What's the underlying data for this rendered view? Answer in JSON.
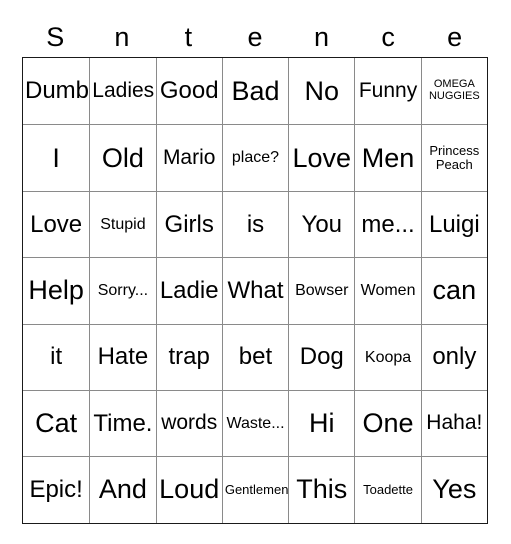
{
  "card": {
    "header_letters": [
      "S",
      "n",
      "t",
      "e",
      "n",
      "c",
      "e"
    ],
    "border_color": "#1a1a1a",
    "gridline_color": "#8a8a8a",
    "background_color": "#ffffff",
    "text_color": "#000000",
    "columns": 7,
    "rows": 7,
    "cells": [
      [
        {
          "text": "Dumb",
          "size": "lg"
        },
        {
          "text": "Ladies",
          "size": "md"
        },
        {
          "text": "Good",
          "size": "lg"
        },
        {
          "text": "Bad",
          "size": "xl"
        },
        {
          "text": "No",
          "size": "xl"
        },
        {
          "text": "Funny",
          "size": "md"
        },
        {
          "text": "OMEGA\nNUGGIES",
          "size": "xxs"
        }
      ],
      [
        {
          "text": "I",
          "size": "xl"
        },
        {
          "text": "Old",
          "size": "xl"
        },
        {
          "text": "Mario",
          "size": "md"
        },
        {
          "text": "place?",
          "size": "sm"
        },
        {
          "text": "Love",
          "size": "xl"
        },
        {
          "text": "Men",
          "size": "xl"
        },
        {
          "text": "Princess\nPeach",
          "size": "xs"
        }
      ],
      [
        {
          "text": "Love",
          "size": "lg"
        },
        {
          "text": "Stupid",
          "size": "sm"
        },
        {
          "text": "Girls",
          "size": "lg"
        },
        {
          "text": "is",
          "size": "lg"
        },
        {
          "text": "You",
          "size": "lg"
        },
        {
          "text": "me...",
          "size": "lg"
        },
        {
          "text": "Luigi",
          "size": "lg"
        }
      ],
      [
        {
          "text": "Help",
          "size": "xl"
        },
        {
          "text": "Sorry...",
          "size": "sm"
        },
        {
          "text": "Ladie",
          "size": "lg"
        },
        {
          "text": "What",
          "size": "lg"
        },
        {
          "text": "Bowser",
          "size": "sm"
        },
        {
          "text": "Women",
          "size": "sm"
        },
        {
          "text": "can",
          "size": "xl"
        }
      ],
      [
        {
          "text": "it",
          "size": "lg"
        },
        {
          "text": "Hate",
          "size": "lg"
        },
        {
          "text": "trap",
          "size": "lg"
        },
        {
          "text": "bet",
          "size": "lg"
        },
        {
          "text": "Dog",
          "size": "lg"
        },
        {
          "text": "Koopa",
          "size": "sm"
        },
        {
          "text": "only",
          "size": "lg"
        }
      ],
      [
        {
          "text": "Cat",
          "size": "xl"
        },
        {
          "text": "Time.",
          "size": "lg"
        },
        {
          "text": "words",
          "size": "md"
        },
        {
          "text": "Waste...",
          "size": "sm"
        },
        {
          "text": "Hi",
          "size": "xl"
        },
        {
          "text": "One",
          "size": "xl"
        },
        {
          "text": "Haha!",
          "size": "md"
        }
      ],
      [
        {
          "text": "Epic!",
          "size": "lg"
        },
        {
          "text": "And",
          "size": "xl"
        },
        {
          "text": "Loud",
          "size": "xl"
        },
        {
          "text": "Gentlemen",
          "size": "xs"
        },
        {
          "text": "This",
          "size": "xl"
        },
        {
          "text": "Toadette",
          "size": "xs"
        },
        {
          "text": "Yes",
          "size": "xl"
        }
      ]
    ]
  }
}
